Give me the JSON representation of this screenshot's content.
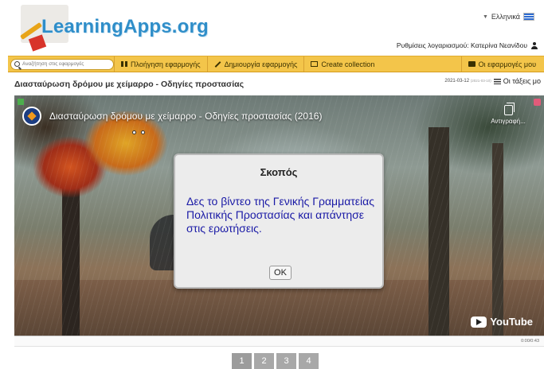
{
  "header": {
    "logo_text": "LearningApps.org",
    "language": "Ελληνικά",
    "account_text": "Ρυθμίσεις λογαριασμού: Κατερίνα Νεανίδου"
  },
  "navbar": {
    "search_placeholder": "Αναζήτηση στις εφαρμογές",
    "browse_label": "Πλοήγηση εφαρμογής",
    "create_label": "Δημιουργία εφαρμογής",
    "collection_label": "Create collection",
    "myapps_label": "Οι εφαρμογές μου",
    "accent_color": "#f3c54a"
  },
  "page": {
    "title": "Διασταύρωση δρόμου με χείμαρρο - Οδηγίες προστασίας",
    "date": "2021-03-12",
    "date_small": "(2021-03-10)",
    "classes_label": "Οι τάξεις μο"
  },
  "video": {
    "title": "Διασταύρωση δρόμου με χείμαρρο - Οδηγίες προστασίας (2016)",
    "copy_label": "Αντιγραφή...",
    "youtube_label": "YouTube",
    "time": "0:00/0:43"
  },
  "dialog": {
    "title": "Σκοπός",
    "body": "Δες το βίντεο της Γενικής Γραμματείας Πολιτικής Προστασίας και απάντησε στις ερωτήσεις.",
    "ok_label": "OK"
  },
  "pagination": {
    "pages": [
      "1",
      "2",
      "3",
      "4"
    ]
  }
}
